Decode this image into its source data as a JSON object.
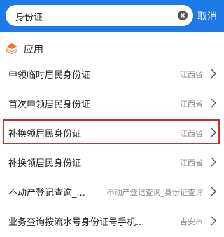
{
  "search": {
    "query": "身份证",
    "cancel_label": "取消"
  },
  "section": {
    "title": "应用"
  },
  "rows": [
    {
      "title": "申领临时居民身份证",
      "region": "江西省"
    },
    {
      "title": "首次申领居民身份证",
      "region": "江西省"
    },
    {
      "title": "补换领居民身份证",
      "region": "江西省"
    },
    {
      "title": "补换领居民身份证",
      "region": "江西省"
    },
    {
      "title": "不动产登记查询_...",
      "region": "不动产登记查询_身份证查询"
    },
    {
      "title": "业务查询按流水号身份证号手机...",
      "region": "吉安市"
    }
  ],
  "colors": {
    "header": "#1e7ae6",
    "highlight": "#c9302c"
  }
}
